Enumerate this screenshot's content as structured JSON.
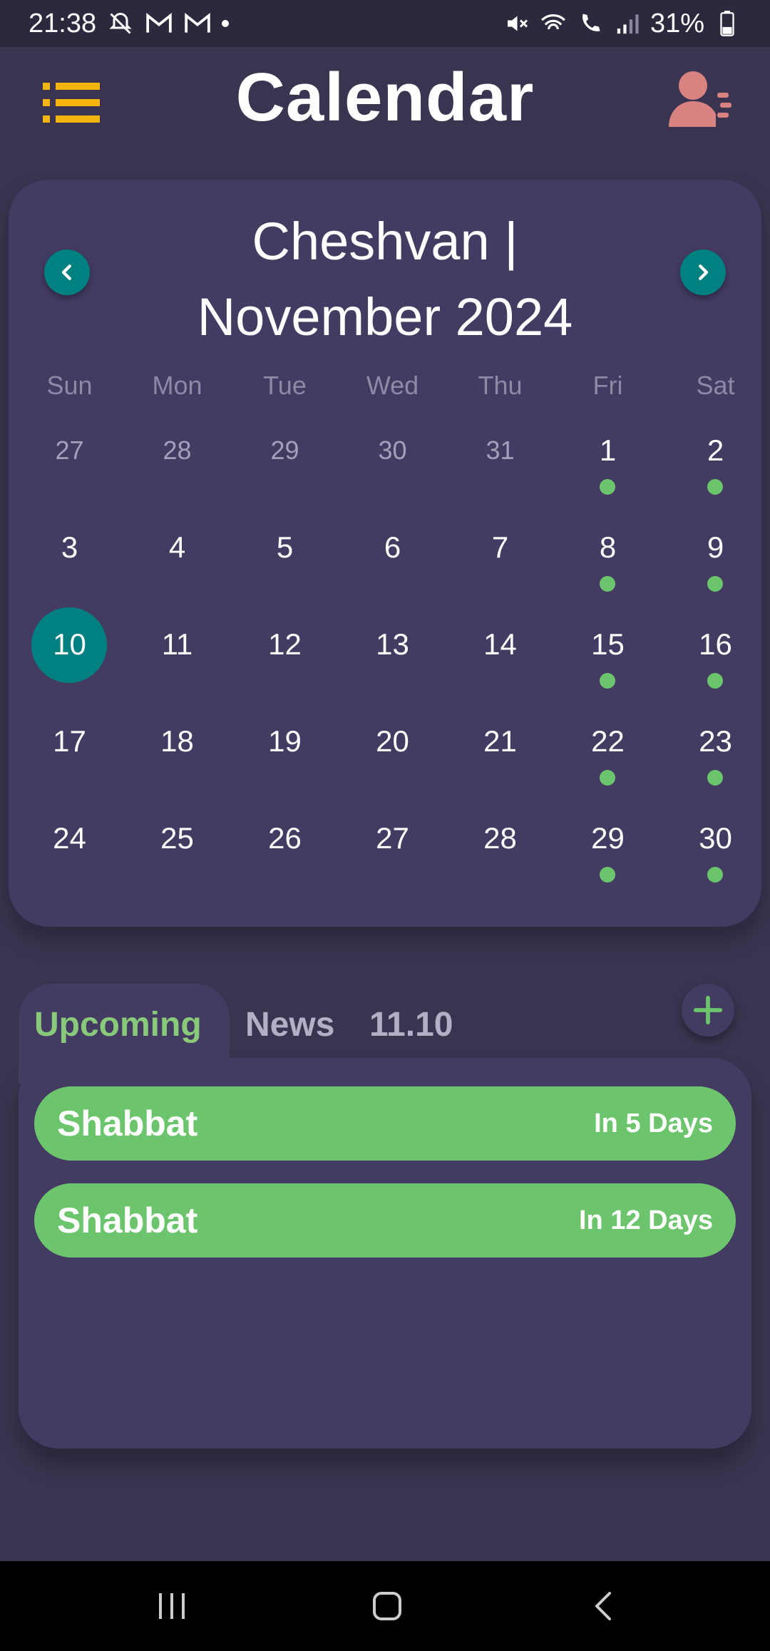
{
  "status_bar": {
    "time": "21:38",
    "battery": "31%",
    "icons_left": [
      "notifications-off-icon",
      "gmail-icon",
      "gmail-icon",
      "dot-icon"
    ],
    "icons_right": [
      "mute-icon",
      "wifi-icon",
      "wifi-calling-icon",
      "signal-icon",
      "battery-icon"
    ]
  },
  "header": {
    "title": "Calendar",
    "menu_icon": "list-icon",
    "profile_icon": "user-settings-icon",
    "accent_menu": "#f5b50f",
    "accent_profile": "#d98282"
  },
  "calendar": {
    "title_line1": "Cheshvan  |",
    "title_line2": "November 2024",
    "prev_icon": "chevron-left-icon",
    "next_icon": "chevron-right-icon",
    "weekdays": [
      "Sun",
      "Mon",
      "Tue",
      "Wed",
      "Thu",
      "Fri",
      "Sat"
    ],
    "weeks": [
      [
        {
          "day": "27",
          "muted": true,
          "event": false
        },
        {
          "day": "28",
          "muted": true,
          "event": false
        },
        {
          "day": "29",
          "muted": true,
          "event": false
        },
        {
          "day": "30",
          "muted": true,
          "event": false
        },
        {
          "day": "31",
          "muted": true,
          "event": false
        },
        {
          "day": "1",
          "muted": false,
          "event": true
        },
        {
          "day": "2",
          "muted": false,
          "event": true
        }
      ],
      [
        {
          "day": "3",
          "muted": false,
          "event": false
        },
        {
          "day": "4",
          "muted": false,
          "event": false
        },
        {
          "day": "5",
          "muted": false,
          "event": false
        },
        {
          "day": "6",
          "muted": false,
          "event": false
        },
        {
          "day": "7",
          "muted": false,
          "event": false
        },
        {
          "day": "8",
          "muted": false,
          "event": true
        },
        {
          "day": "9",
          "muted": false,
          "event": true
        }
      ],
      [
        {
          "day": "10",
          "muted": false,
          "event": false,
          "today": true
        },
        {
          "day": "11",
          "muted": false,
          "event": false
        },
        {
          "day": "12",
          "muted": false,
          "event": false
        },
        {
          "day": "13",
          "muted": false,
          "event": false
        },
        {
          "day": "14",
          "muted": false,
          "event": false
        },
        {
          "day": "15",
          "muted": false,
          "event": true
        },
        {
          "day": "16",
          "muted": false,
          "event": true
        }
      ],
      [
        {
          "day": "17",
          "muted": false,
          "event": false
        },
        {
          "day": "18",
          "muted": false,
          "event": false
        },
        {
          "day": "19",
          "muted": false,
          "event": false
        },
        {
          "day": "20",
          "muted": false,
          "event": false
        },
        {
          "day": "21",
          "muted": false,
          "event": false
        },
        {
          "day": "22",
          "muted": false,
          "event": true
        },
        {
          "day": "23",
          "muted": false,
          "event": true
        }
      ],
      [
        {
          "day": "24",
          "muted": false,
          "event": false
        },
        {
          "day": "25",
          "muted": false,
          "event": false
        },
        {
          "day": "26",
          "muted": false,
          "event": false
        },
        {
          "day": "27",
          "muted": false,
          "event": false
        },
        {
          "day": "28",
          "muted": false,
          "event": false
        },
        {
          "day": "29",
          "muted": false,
          "event": true
        },
        {
          "day": "30",
          "muted": false,
          "event": true
        }
      ]
    ],
    "colors": {
      "today": "#008080",
      "event_dot": "#6cc56c"
    }
  },
  "tabs": {
    "items": [
      "Upcoming",
      "News",
      "11.10"
    ],
    "active": "Upcoming",
    "add_icon": "plus-icon"
  },
  "events": [
    {
      "name": "Shabbat",
      "when": "In 5 Days"
    },
    {
      "name": "Shabbat",
      "when": "In 12 Days"
    }
  ],
  "nav_bar": {
    "buttons": [
      "recents-icon",
      "home-icon",
      "back-icon"
    ]
  }
}
